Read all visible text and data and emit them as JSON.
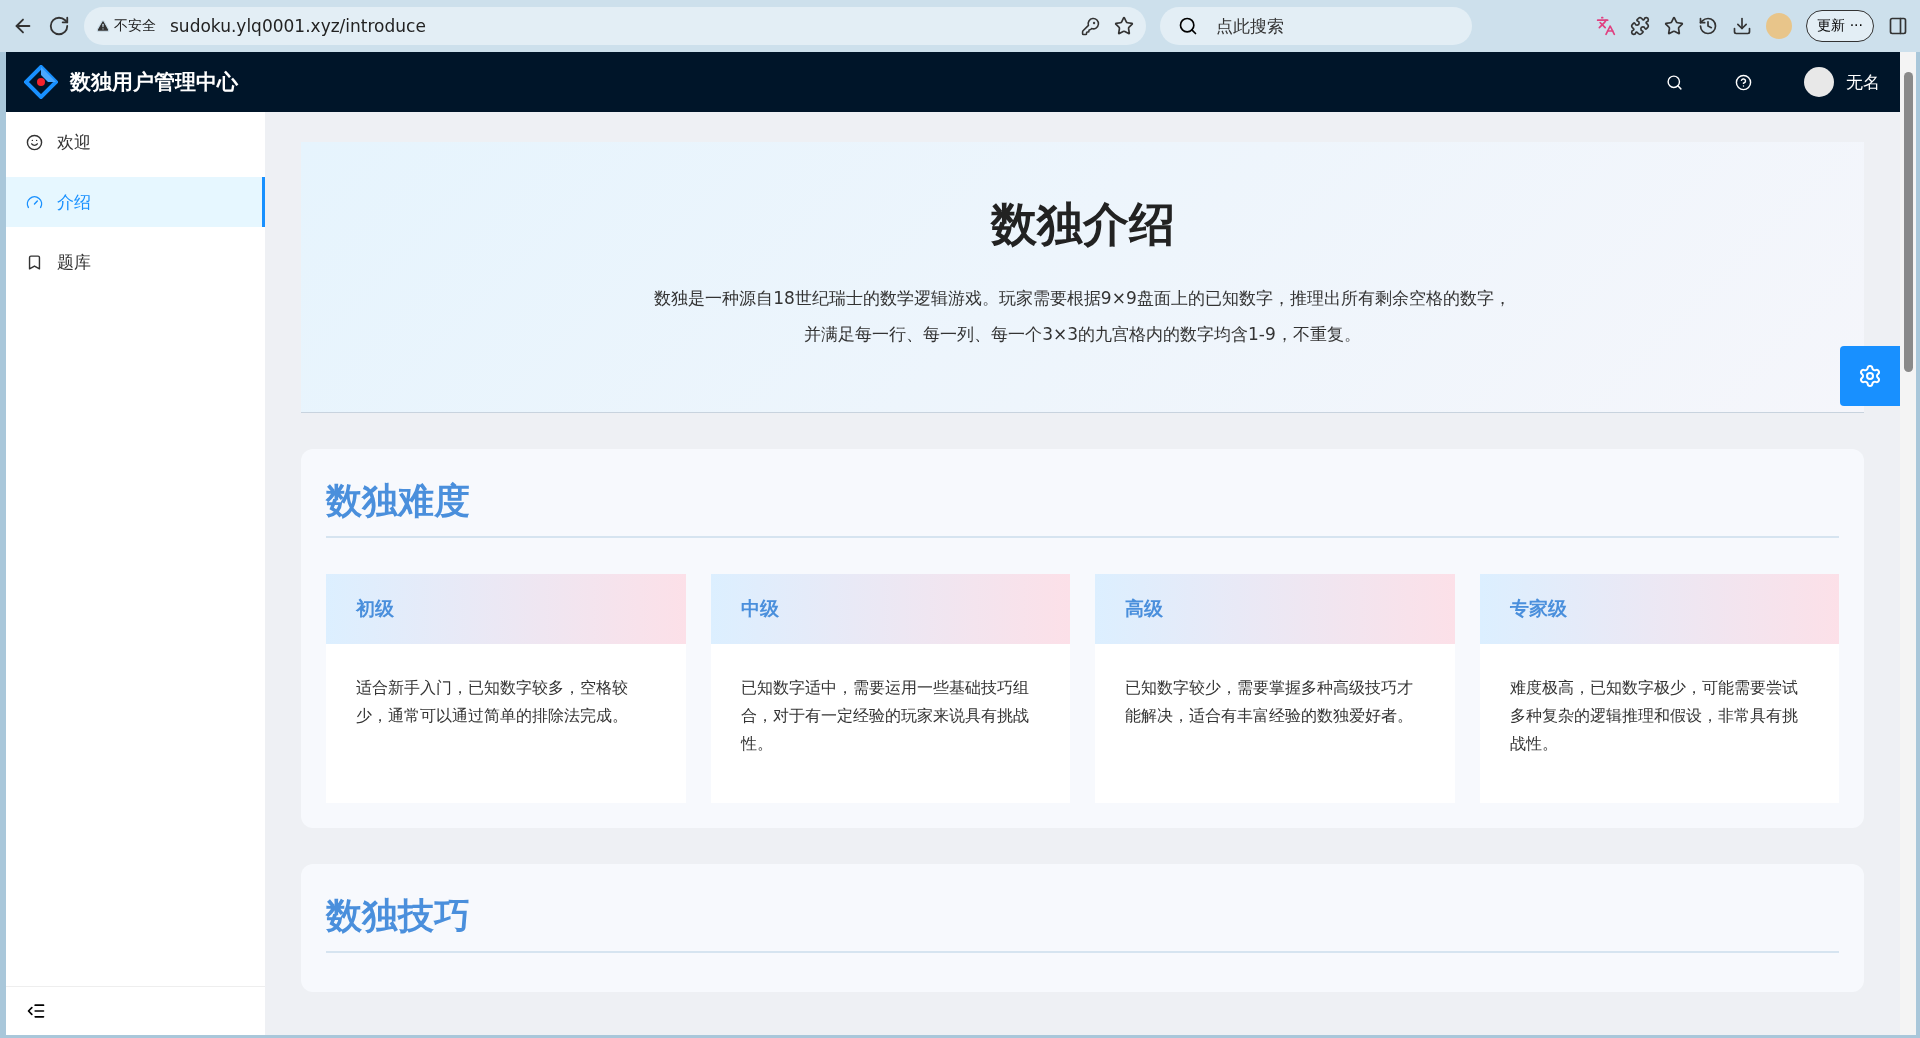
{
  "browser": {
    "security": "不安全",
    "url": "sudoku.ylq0001.xyz/introduce",
    "search_placeholder": "点此搜索",
    "update_button": "更新",
    "more": "···"
  },
  "header": {
    "title": "数独用户管理中心",
    "user": "无名"
  },
  "sidebar": {
    "items": [
      {
        "label": "欢迎",
        "kind": "smile",
        "selected": false
      },
      {
        "label": "介绍",
        "kind": "dashboard",
        "selected": true
      },
      {
        "label": "题库",
        "kind": "book",
        "selected": false
      }
    ]
  },
  "hero": {
    "title": "数独介绍",
    "lines": [
      "数独是一种源自18世纪瑞士的数学逻辑游戏。玩家需要根据9×9盘面上的已知数字，推理出所有剩余空格的数字，",
      "并满足每一行、每一列、每一个3×3的九宫格内的数字均含1-9，不重复。"
    ]
  },
  "sections": [
    {
      "title": "数独难度",
      "cards": [
        {
          "title": "初级",
          "text": "适合新手入门，已知数字较多，空格较少，通常可以通过简单的排除法完成。"
        },
        {
          "title": "中级",
          "text": "已知数字适中，需要运用一些基础技巧组合，对于有一定经验的玩家来说具有挑战性。"
        },
        {
          "title": "高级",
          "text": "已知数字较少，需要掌握多种高级技巧才能解决，适合有丰富经验的数独爱好者。"
        },
        {
          "title": "专家级",
          "text": "难度极高，已知数字极少，可能需要尝试多种复杂的逻辑推理和假设，非常具有挑战性。"
        }
      ]
    },
    {
      "title": "数独技巧"
    }
  ]
}
